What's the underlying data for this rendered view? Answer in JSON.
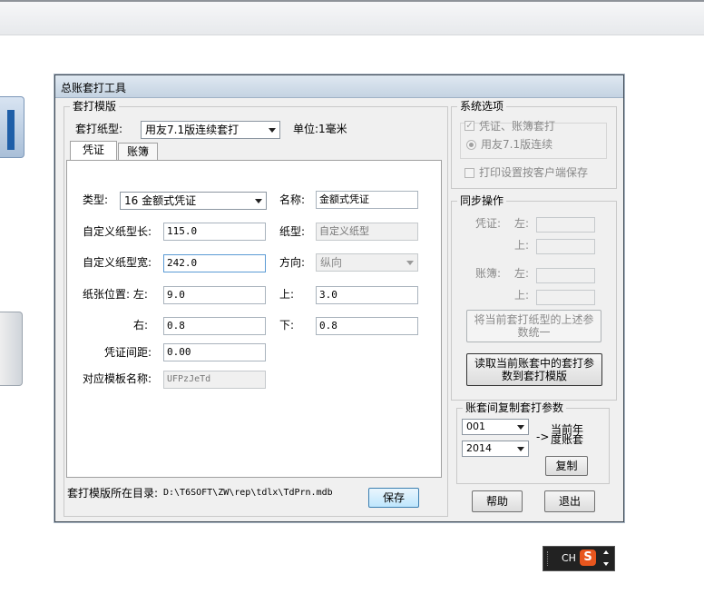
{
  "window": {
    "title": "总账套打工具"
  },
  "template_group": {
    "caption": "套打模版",
    "paper_type_label": "套打纸型:",
    "paper_type_value": "用友7.1版连续套打",
    "unit_label": "单位:1毫米",
    "tabs": [
      {
        "label": "凭证"
      },
      {
        "label": "账簿"
      }
    ],
    "voucher": {
      "type_label": "类型:",
      "type_value": "16 金额式凭证",
      "name_label": "名称:",
      "name_value": "金额式凭证",
      "custom_length_label": "自定义纸型长:",
      "custom_length_value": "115.0",
      "paper_label": "纸型:",
      "paper_value": "自定义纸型",
      "custom_width_label": "自定义纸型宽:",
      "custom_width_value": "242.0",
      "direction_label": "方向:",
      "direction_value": "纵向",
      "position_label": "纸张位置: 左:",
      "left_value": "9.0",
      "top_label": "上:",
      "top_value": "3.0",
      "right_label": "右:",
      "right_value": "0.8",
      "bottom_label": "下:",
      "bottom_value": "0.8",
      "spacing_label": "凭证间距:",
      "spacing_value": "0.00",
      "template_name_label": "对应模板名称:",
      "template_name_value": "UFPzJeTd"
    },
    "directory_label": "套打模版所在目录:",
    "directory_value": "D:\\T6SOFT\\ZW\\rep\\tdlx\\TdPrn.mdb",
    "save_button": "保存"
  },
  "system_options": {
    "caption": "系统选项",
    "voucher_ledger_check": "凭证、账簿套打",
    "yonyou_radio": "用友7.1版连续",
    "client_print_check": "打印设置按客户端保存"
  },
  "sync": {
    "caption": "同步操作",
    "voucher_label": "凭证:",
    "ledger_label": "账簿:",
    "left_label": "左:",
    "top_label": "上:",
    "unify_button": "将当前套打纸型的上述参数统一",
    "read_button": "读取当前账套中的套打参数到套打模版"
  },
  "copy": {
    "caption": "账套间复制套打参数",
    "account_value": "001",
    "year_value": "2014",
    "arrow_text": "->",
    "target_text": "当前年度账套",
    "copy_button": "复制"
  },
  "footer": {
    "help_button": "帮助",
    "exit_button": "退出"
  },
  "tray": {
    "ime_label": "CH",
    "ime_logo": "S"
  }
}
